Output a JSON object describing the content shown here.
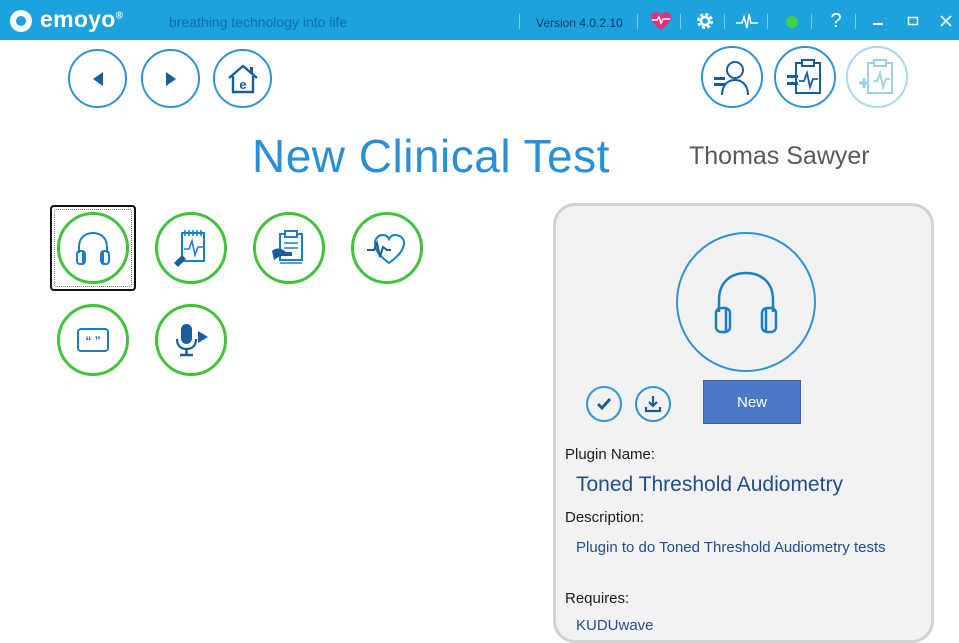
{
  "titlebar": {
    "brand": "emoyo",
    "brand_mark": "®",
    "tagline": "breathing technology into life",
    "version": "Version 4.0.2.10",
    "status_color": "#3fd04a",
    "accent_color": "#1ea2dd"
  },
  "nav": {
    "back_icon": "back-arrow-icon",
    "forward_icon": "forward-arrow-icon",
    "home_icon": "home-icon"
  },
  "header_actions": {
    "patient_icon": "patient-icon",
    "clinical_icon": "clipboard-ecg-icon",
    "add_clinical_icon": "add-clipboard-ecg-icon"
  },
  "page": {
    "title": "New Clinical Test",
    "patient_name": "Thomas Sawyer"
  },
  "plugins": [
    {
      "icon": "headphones-icon",
      "selected": true
    },
    {
      "icon": "notepad-ecg-icon",
      "selected": false
    },
    {
      "icon": "clipboard-hand-icon",
      "selected": false
    },
    {
      "icon": "heart-ecg-icon",
      "selected": false
    },
    {
      "icon": "quote-message-icon",
      "selected": false
    },
    {
      "icon": "microphone-play-icon",
      "selected": false
    }
  ],
  "detail": {
    "icon": "headphones-icon",
    "new_button": "New",
    "plugin_name_label": "Plugin Name:",
    "plugin_name": "Toned Threshold Audiometry",
    "description_label": "Description:",
    "description": "Plugin to do Toned Threshold Audiometry tests",
    "requires_label": "Requires:",
    "requires": "KUDUwave"
  },
  "colors": {
    "plugin_ring": "#45c23d",
    "nav_ring": "#2f93d4",
    "title": "#2a8fd6",
    "new_button": "#4b79c8"
  }
}
